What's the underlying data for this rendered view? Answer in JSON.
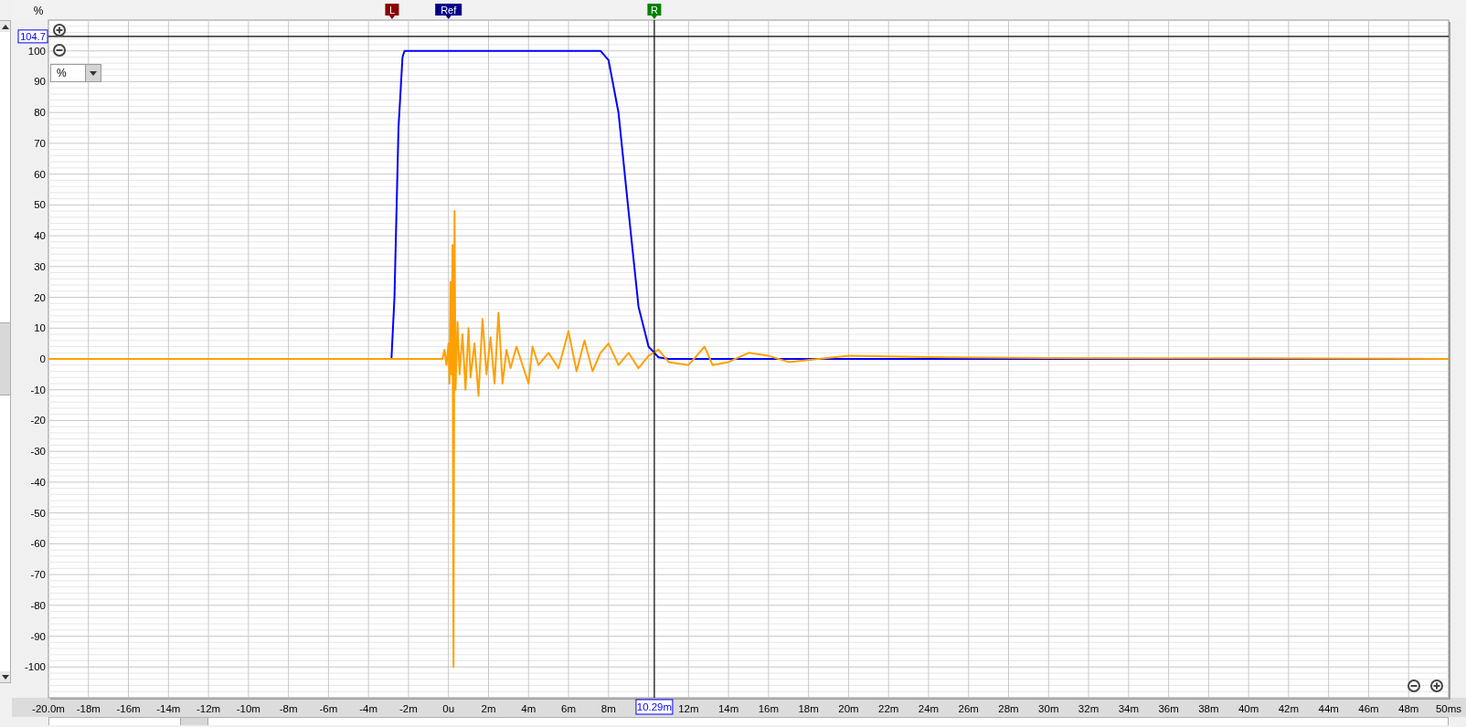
{
  "y_unit": "%",
  "units_select": {
    "value": "%"
  },
  "chart_data": {
    "type": "line",
    "xlim": [
      -20,
      50
    ],
    "ylim": [
      -110,
      110
    ],
    "xticks": [
      {
        "value": -20,
        "label": "-20.0m"
      },
      {
        "value": -18,
        "label": "-18m"
      },
      {
        "value": -16,
        "label": "-16m"
      },
      {
        "value": -14,
        "label": "-14m"
      },
      {
        "value": -12,
        "label": "-12m"
      },
      {
        "value": -10,
        "label": "-10m"
      },
      {
        "value": -8,
        "label": "-8m"
      },
      {
        "value": -6,
        "label": "-6m"
      },
      {
        "value": -4,
        "label": "-4m"
      },
      {
        "value": -2,
        "label": "-2m"
      },
      {
        "value": 0,
        "label": "0u"
      },
      {
        "value": 2,
        "label": "2m"
      },
      {
        "value": 4,
        "label": "4m"
      },
      {
        "value": 6,
        "label": "6m"
      },
      {
        "value": 8,
        "label": "8m"
      },
      {
        "value": 12,
        "label": "12m"
      },
      {
        "value": 14,
        "label": "14m"
      },
      {
        "value": 16,
        "label": "16m"
      },
      {
        "value": 18,
        "label": "18m"
      },
      {
        "value": 20,
        "label": "20m"
      },
      {
        "value": 22,
        "label": "22m"
      },
      {
        "value": 24,
        "label": "24m"
      },
      {
        "value": 26,
        "label": "26m"
      },
      {
        "value": 28,
        "label": "28m"
      },
      {
        "value": 30,
        "label": "30m"
      },
      {
        "value": 32,
        "label": "32m"
      },
      {
        "value": 34,
        "label": "34m"
      },
      {
        "value": 36,
        "label": "36m"
      },
      {
        "value": 38,
        "label": "38m"
      },
      {
        "value": 40,
        "label": "40m"
      },
      {
        "value": 42,
        "label": "42m"
      },
      {
        "value": 44,
        "label": "44m"
      },
      {
        "value": 46,
        "label": "46m"
      },
      {
        "value": 48,
        "label": "48m"
      },
      {
        "value": 50,
        "label": "50ms"
      }
    ],
    "yticks": [
      100,
      90,
      80,
      70,
      60,
      50,
      40,
      30,
      20,
      10,
      0,
      -10,
      -20,
      -30,
      -40,
      -50,
      -60,
      -70,
      -80,
      -90,
      -100
    ],
    "x": [
      -20,
      -3,
      -2.85,
      -2.7,
      -2.5,
      -2.3,
      -2.2,
      -0.3,
      -0.2,
      -0.1,
      0,
      0.05,
      0.1,
      0.15,
      0.2,
      0.25,
      0.3,
      0.35,
      0.45,
      0.55,
      0.7,
      0.85,
      1,
      1.1,
      1.3,
      1.5,
      1.7,
      1.9,
      2.1,
      2.3,
      2.5,
      2.7,
      2.9,
      3.1,
      3.4,
      3.7,
      4,
      4.2,
      4.5,
      5,
      5.5,
      6,
      6.4,
      6.8,
      7.2,
      7.6,
      8,
      8.5,
      9,
      9.5,
      10,
      10.5,
      11,
      12,
      12.8,
      13.2,
      14,
      15,
      16,
      17,
      20,
      25,
      30,
      40,
      50
    ],
    "series": [
      {
        "color": "#0000ff",
        "values": [
          0,
          0,
          0,
          20,
          75,
          98,
          100,
          100,
          100,
          100,
          100,
          100,
          100,
          100,
          100,
          100,
          100,
          100,
          100,
          100,
          100,
          100,
          100,
          100,
          100,
          100,
          100,
          100,
          100,
          100,
          100,
          100,
          100,
          100,
          100,
          100,
          100,
          100,
          100,
          100,
          100,
          100,
          100,
          100,
          100,
          100,
          97,
          80,
          48,
          17,
          4,
          0.5,
          0,
          0,
          0,
          0,
          0,
          0,
          0,
          0,
          0,
          0,
          0,
          0,
          0
        ]
      },
      {
        "color": "#ffa000",
        "values": [
          0,
          0,
          0,
          0,
          0,
          0,
          0,
          0,
          3,
          -2,
          5,
          -8,
          25,
          -5,
          37,
          -100,
          48,
          -10,
          12,
          -5,
          8,
          -10,
          10,
          -6,
          5,
          -12,
          13,
          -5,
          7,
          -8,
          15,
          -8,
          3,
          -3,
          4,
          -2,
          -8,
          4,
          -2,
          2,
          -3,
          9,
          -4,
          6,
          -4,
          2,
          5,
          -2,
          2,
          -3,
          1,
          3,
          -1,
          -2,
          4,
          -2,
          -1,
          2,
          1,
          -1,
          1,
          0.5,
          0.3,
          0.2,
          0
        ]
      }
    ],
    "grid": true,
    "ref_lines": [
      {
        "axis": "x",
        "value": 10.29,
        "label": "10.29m"
      },
      {
        "axis": "y",
        "value": 104.7,
        "label": "104.7"
      }
    ]
  },
  "marker_handles": [
    {
      "label": "L",
      "color": "#8b0000",
      "level": 0.2454
    },
    {
      "label": "Ref",
      "color": "#00008b",
      "level": 0.2857
    },
    {
      "label": "R",
      "color": "#008000",
      "level": 0.4327
    }
  ]
}
